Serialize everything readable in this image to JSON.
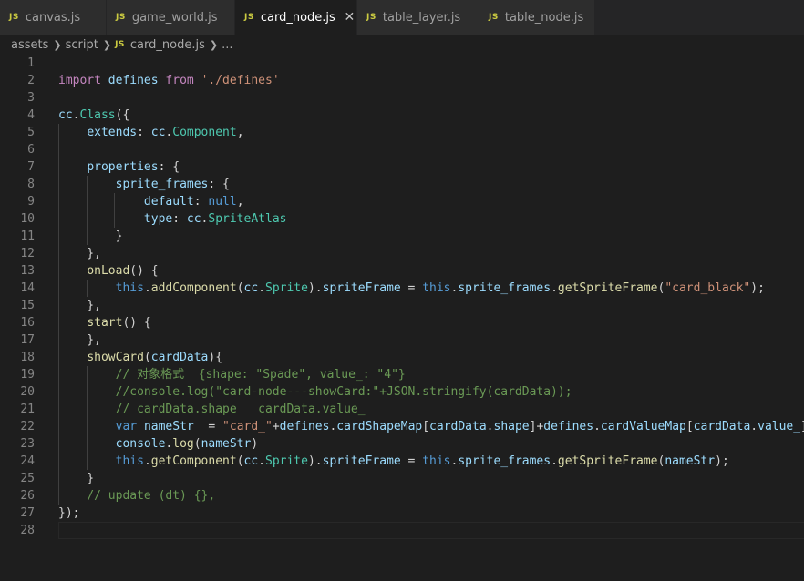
{
  "tabs": [
    {
      "label": "canvas.js",
      "icon": "JS",
      "active": false
    },
    {
      "label": "game_world.js",
      "icon": "JS",
      "active": false
    },
    {
      "label": "card_node.js",
      "icon": "JS",
      "active": true
    },
    {
      "label": "table_layer.js",
      "icon": "JS",
      "active": false
    },
    {
      "label": "table_node.js",
      "icon": "JS",
      "active": false
    }
  ],
  "tab_close_glyph": "✕",
  "breadcrumb": {
    "items": [
      "assets",
      "script",
      "card_node.js",
      "..."
    ],
    "file_icon": "JS"
  },
  "colors": {
    "background": "#1e1e1e",
    "tab_inactive": "#2d2d2d",
    "js_icon": "#cbcb41",
    "keyword_control": "#c586c0",
    "keyword": "#569cd6",
    "variable": "#9cdcfe",
    "function": "#dcdcaa",
    "string": "#ce9178",
    "comment": "#6a9955",
    "type": "#4ec9b0"
  },
  "editor": {
    "current_line": 28,
    "lines": [
      [],
      [
        [
          "k",
          "import"
        ],
        [
          "p",
          " "
        ],
        [
          "v",
          "defines"
        ],
        [
          "p",
          " "
        ],
        [
          "k",
          "from"
        ],
        [
          "p",
          " "
        ],
        [
          "s",
          "'./defines'"
        ]
      ],
      [],
      [
        [
          "v",
          "cc"
        ],
        [
          "p",
          "."
        ],
        [
          "t",
          "Class"
        ],
        [
          "p",
          "({"
        ]
      ],
      [
        [
          "p",
          "    "
        ],
        [
          "v",
          "extends"
        ],
        [
          "p",
          ": "
        ],
        [
          "v",
          "cc"
        ],
        [
          "p",
          "."
        ],
        [
          "t",
          "Component"
        ],
        [
          "p",
          ","
        ]
      ],
      [],
      [
        [
          "p",
          "    "
        ],
        [
          "v",
          "properties"
        ],
        [
          "p",
          ": {"
        ]
      ],
      [
        [
          "p",
          "        "
        ],
        [
          "v",
          "sprite_frames"
        ],
        [
          "p",
          ": {"
        ]
      ],
      [
        [
          "p",
          "            "
        ],
        [
          "v",
          "default"
        ],
        [
          "p",
          ": "
        ],
        [
          "kw",
          "null"
        ],
        [
          "p",
          ","
        ]
      ],
      [
        [
          "p",
          "            "
        ],
        [
          "v",
          "type"
        ],
        [
          "p",
          ": "
        ],
        [
          "v",
          "cc"
        ],
        [
          "p",
          "."
        ],
        [
          "t",
          "SpriteAtlas"
        ]
      ],
      [
        [
          "p",
          "        }"
        ]
      ],
      [
        [
          "p",
          "    },"
        ]
      ],
      [
        [
          "p",
          "    "
        ],
        [
          "f",
          "onLoad"
        ],
        [
          "p",
          "() {"
        ]
      ],
      [
        [
          "p",
          "        "
        ],
        [
          "kw",
          "this"
        ],
        [
          "p",
          "."
        ],
        [
          "f",
          "addComponent"
        ],
        [
          "p",
          "("
        ],
        [
          "v",
          "cc"
        ],
        [
          "p",
          "."
        ],
        [
          "t",
          "Sprite"
        ],
        [
          "p",
          ")."
        ],
        [
          "v",
          "spriteFrame"
        ],
        [
          "p",
          " = "
        ],
        [
          "kw",
          "this"
        ],
        [
          "p",
          "."
        ],
        [
          "v",
          "sprite_frames"
        ],
        [
          "p",
          "."
        ],
        [
          "f",
          "getSpriteFrame"
        ],
        [
          "p",
          "("
        ],
        [
          "s",
          "\"card_black\""
        ],
        [
          "p",
          ");"
        ]
      ],
      [
        [
          "p",
          "    },"
        ]
      ],
      [
        [
          "p",
          "    "
        ],
        [
          "f",
          "start"
        ],
        [
          "p",
          "() {"
        ]
      ],
      [
        [
          "p",
          "    },"
        ]
      ],
      [
        [
          "p",
          "    "
        ],
        [
          "f",
          "showCard"
        ],
        [
          "p",
          "("
        ],
        [
          "v",
          "cardData"
        ],
        [
          "p",
          "){"
        ]
      ],
      [
        [
          "p",
          "        "
        ],
        [
          "c",
          "// 对象格式  {shape: \"Spade\", value_: \"4\"}"
        ]
      ],
      [
        [
          "p",
          "        "
        ],
        [
          "c",
          "//console.log(\"card-node---showCard:\"+JSON.stringify(cardData));"
        ]
      ],
      [
        [
          "p",
          "        "
        ],
        [
          "c",
          "// cardData.shape   cardData.value_"
        ]
      ],
      [
        [
          "p",
          "        "
        ],
        [
          "kw",
          "var"
        ],
        [
          "p",
          " "
        ],
        [
          "v",
          "nameStr"
        ],
        [
          "p",
          "  = "
        ],
        [
          "s",
          "\"card_\""
        ],
        [
          "p",
          "+"
        ],
        [
          "v",
          "defines"
        ],
        [
          "p",
          "."
        ],
        [
          "v",
          "cardShapeMap"
        ],
        [
          "p",
          "["
        ],
        [
          "v",
          "cardData"
        ],
        [
          "p",
          "."
        ],
        [
          "v",
          "shape"
        ],
        [
          "p",
          "]+"
        ],
        [
          "v",
          "defines"
        ],
        [
          "p",
          "."
        ],
        [
          "v",
          "cardValueMap"
        ],
        [
          "p",
          "["
        ],
        [
          "v",
          "cardData"
        ],
        [
          "p",
          "."
        ],
        [
          "v",
          "value_"
        ],
        [
          "p",
          "];"
        ]
      ],
      [
        [
          "p",
          "        "
        ],
        [
          "v",
          "console"
        ],
        [
          "p",
          "."
        ],
        [
          "f",
          "log"
        ],
        [
          "p",
          "("
        ],
        [
          "v",
          "nameStr"
        ],
        [
          "p",
          ")"
        ]
      ],
      [
        [
          "p",
          "        "
        ],
        [
          "kw",
          "this"
        ],
        [
          "p",
          "."
        ],
        [
          "f",
          "getComponent"
        ],
        [
          "p",
          "("
        ],
        [
          "v",
          "cc"
        ],
        [
          "p",
          "."
        ],
        [
          "t",
          "Sprite"
        ],
        [
          "p",
          ")."
        ],
        [
          "v",
          "spriteFrame"
        ],
        [
          "p",
          " = "
        ],
        [
          "kw",
          "this"
        ],
        [
          "p",
          "."
        ],
        [
          "v",
          "sprite_frames"
        ],
        [
          "p",
          "."
        ],
        [
          "f",
          "getSpriteFrame"
        ],
        [
          "p",
          "("
        ],
        [
          "v",
          "nameStr"
        ],
        [
          "p",
          ");"
        ]
      ],
      [
        [
          "p",
          "    }"
        ]
      ],
      [
        [
          "p",
          "    "
        ],
        [
          "c",
          "// update (dt) {},"
        ]
      ],
      [
        [
          "p",
          "});"
        ]
      ],
      []
    ]
  }
}
